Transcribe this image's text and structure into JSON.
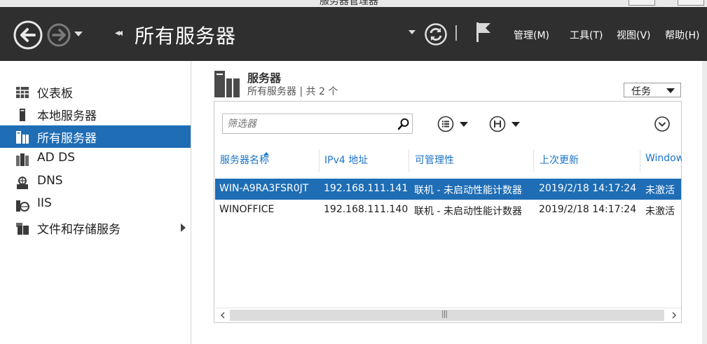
{
  "window": {
    "title": "服务器管理器"
  },
  "header": {
    "breadcrumb_arrows": "◂◂",
    "breadcrumb": "所有服务器",
    "menu": {
      "manage": "管理(M)",
      "tools": "工具(T)",
      "view": "视图(V)",
      "help": "帮助(H)"
    }
  },
  "sidebar": {
    "items": [
      {
        "label": "仪表板",
        "icon": "dashboard-icon"
      },
      {
        "label": "本地服务器",
        "icon": "server-icon"
      },
      {
        "label": "所有服务器",
        "icon": "servers-icon",
        "selected": true
      },
      {
        "label": "AD DS",
        "icon": "adds-icon"
      },
      {
        "label": "DNS",
        "icon": "dns-icon"
      },
      {
        "label": "IIS",
        "icon": "iis-icon"
      },
      {
        "label": "文件和存储服务",
        "icon": "file-storage-icon",
        "expandable": true
      }
    ]
  },
  "main": {
    "title": "服务器",
    "subtitle": "所有服务器 | 共 2 个",
    "tasks_label": "任务",
    "filter_placeholder": "筛选器",
    "columns": [
      "服务器名称",
      "IPv4 地址",
      "可管理性",
      "上次更新",
      "Window"
    ],
    "rows": [
      [
        "WIN-A9RA3FSR0JT",
        "192.168.111.141",
        "联机 - 未启动性能计数器",
        "2019/2/18 14:17:24",
        "未激活"
      ],
      [
        "WINOFFICE",
        "192.168.111.140",
        "联机 - 未启动性能计数器",
        "2019/2/18 14:17:24",
        "未激活"
      ]
    ],
    "selected_row": 0,
    "scroll_thumb_glyph": "|||"
  },
  "colors": {
    "header_bg": "#2f2f2f",
    "selection": "#1e6db5",
    "column_header_text": "#1a73c9"
  }
}
